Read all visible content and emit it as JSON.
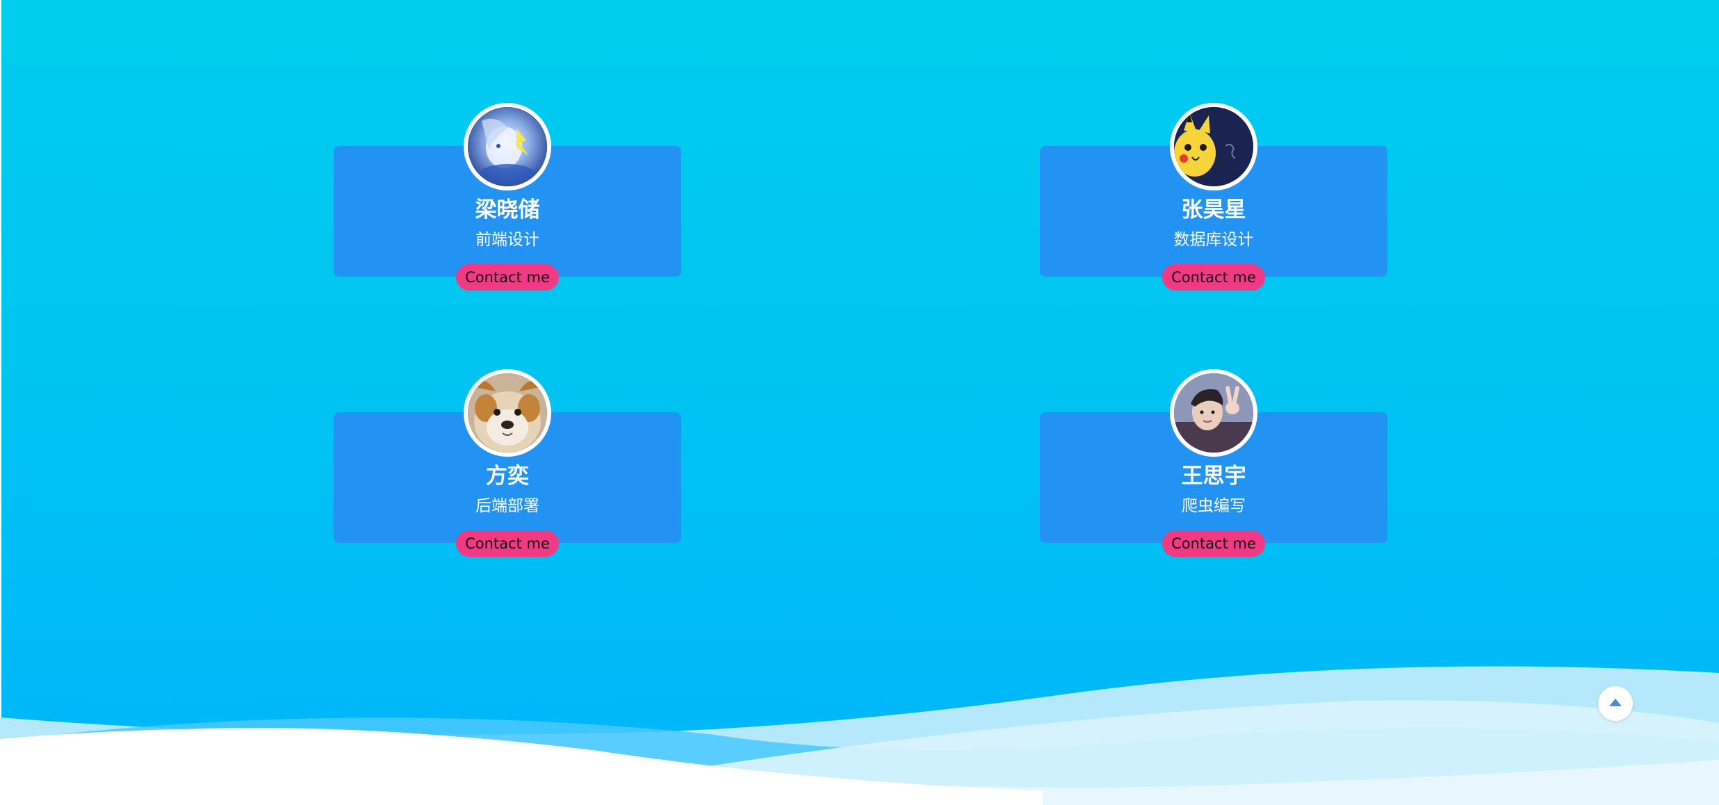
{
  "members": [
    {
      "name": "梁晓储",
      "role": "前端设计",
      "contact_label": "Contact me",
      "avatar_icon": "anime-character-avatar"
    },
    {
      "name": "张昊星",
      "role": "数据库设计",
      "contact_label": "Contact me",
      "avatar_icon": "pikachu-avatar"
    },
    {
      "name": "方奕",
      "role": "后端部署",
      "contact_label": "Contact me",
      "avatar_icon": "dog-avatar"
    },
    {
      "name": "王思宇",
      "role": "爬虫编写",
      "contact_label": "Contact me",
      "avatar_icon": "person-peace-sign-avatar"
    }
  ],
  "back_to_top_icon": "caret-up-icon",
  "colors": {
    "background_top": "#00cdee",
    "background_bottom": "#00b5fb",
    "card": "#2293f3",
    "contact_button": "#f23a84",
    "text": "#ffffff"
  }
}
